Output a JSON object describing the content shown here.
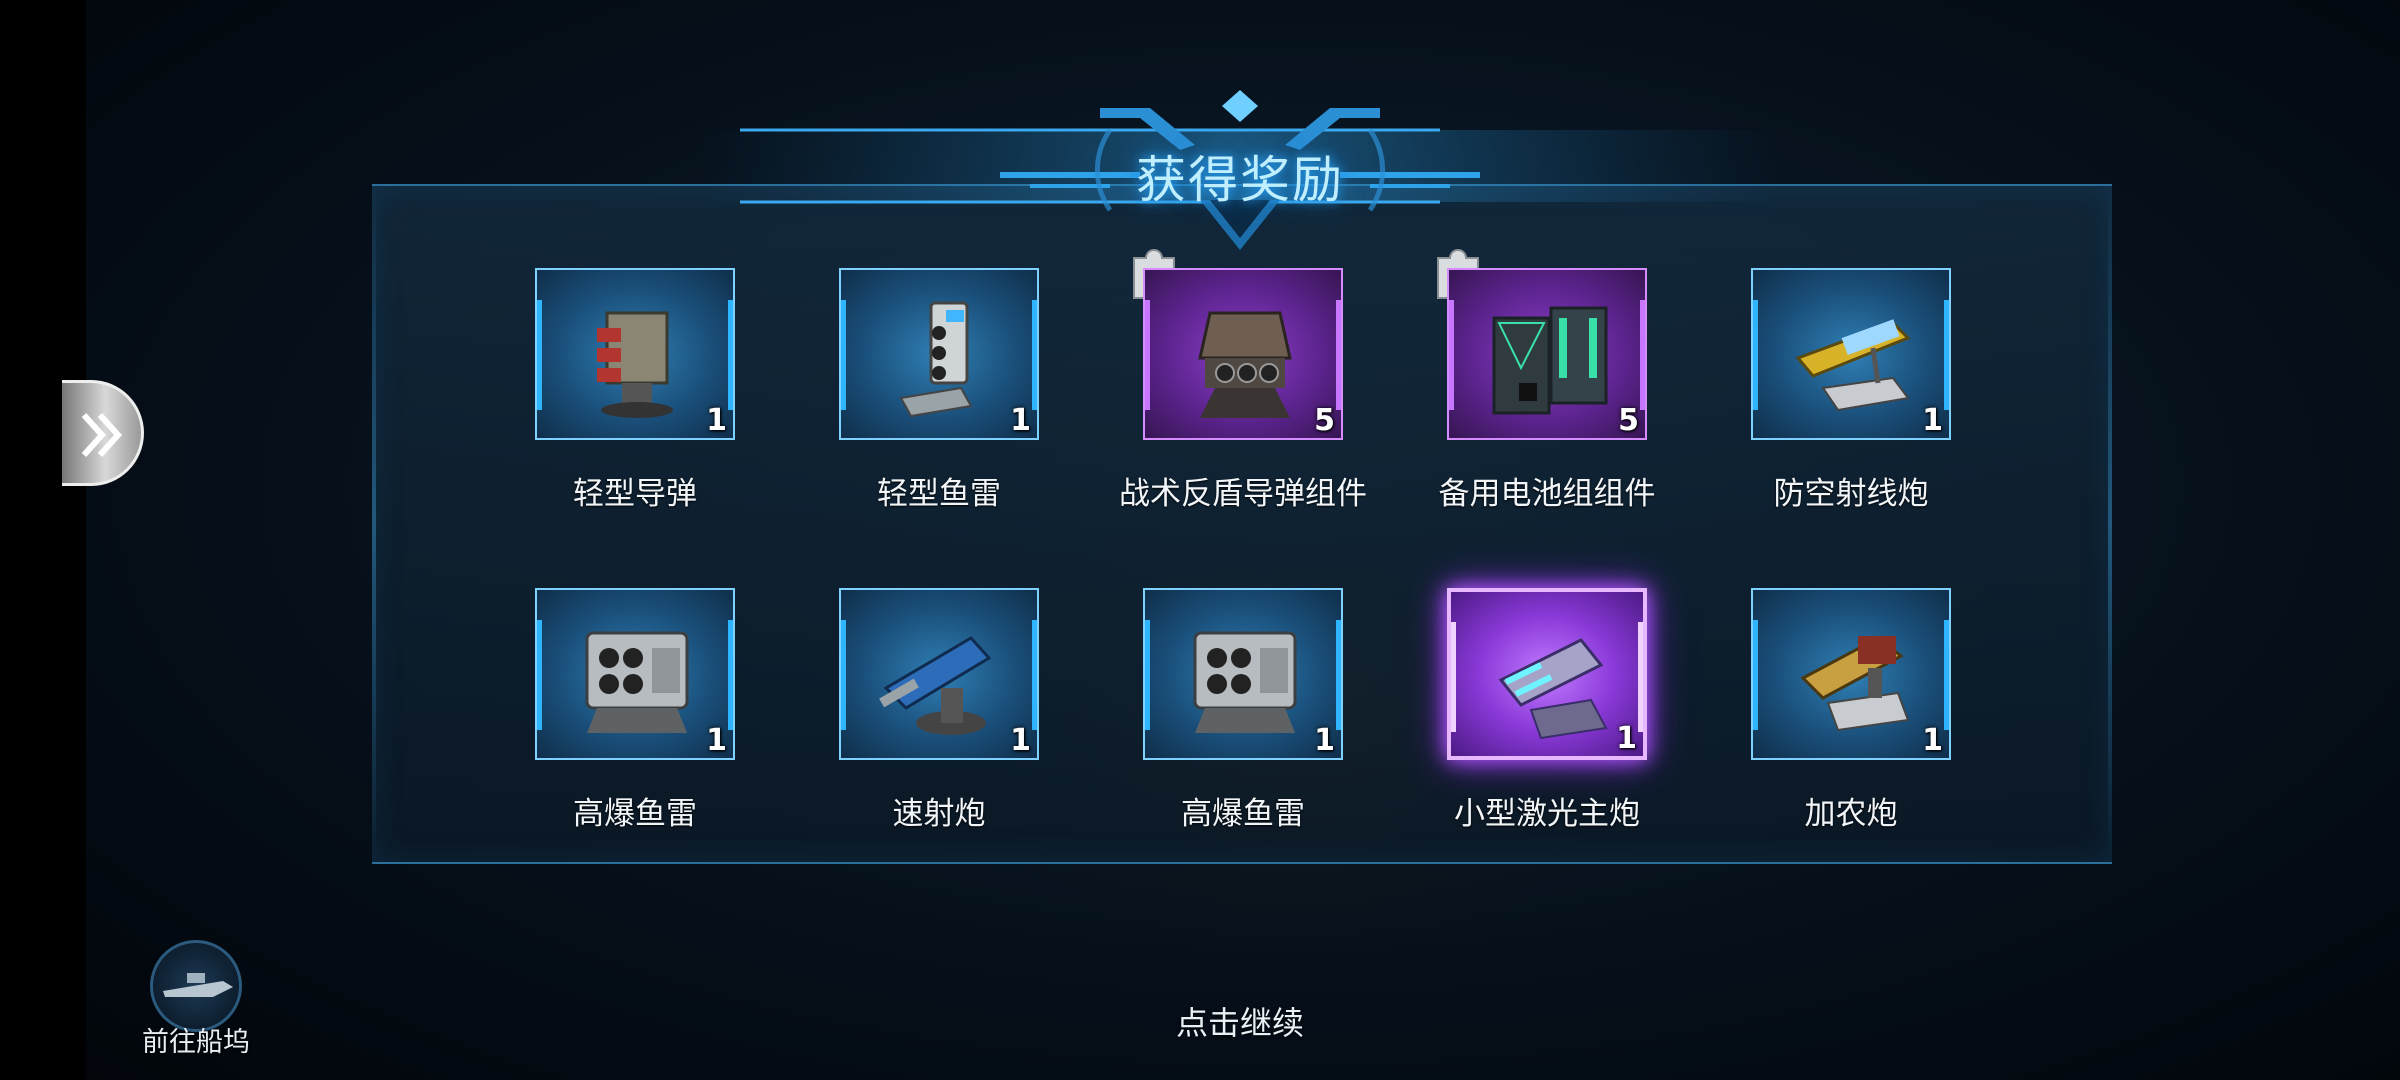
{
  "title": "获得奖励",
  "items": [
    {
      "name": "轻型导弹",
      "count": "1",
      "rarity": "blue",
      "fragment": false,
      "icon": "missile-launcher-icon"
    },
    {
      "name": "轻型鱼雷",
      "count": "1",
      "rarity": "blue",
      "fragment": false,
      "icon": "torpedo-launcher-icon"
    },
    {
      "name": "战术反盾导弹组件",
      "count": "5",
      "rarity": "purple",
      "fragment": true,
      "icon": "anti-shield-missile-icon"
    },
    {
      "name": "备用电池组组件",
      "count": "5",
      "rarity": "purple",
      "fragment": true,
      "icon": "battery-pack-icon"
    },
    {
      "name": "防空射线炮",
      "count": "1",
      "rarity": "blue",
      "fragment": false,
      "icon": "aa-ray-cannon-icon"
    },
    {
      "name": "高爆鱼雷",
      "count": "1",
      "rarity": "blue",
      "fragment": false,
      "icon": "he-torpedo-icon"
    },
    {
      "name": "速射炮",
      "count": "1",
      "rarity": "blue",
      "fragment": false,
      "icon": "rapid-fire-cannon-icon"
    },
    {
      "name": "高爆鱼雷",
      "count": "1",
      "rarity": "blue",
      "fragment": false,
      "icon": "he-torpedo-icon"
    },
    {
      "name": "小型激光主炮",
      "count": "1",
      "rarity": "glow",
      "fragment": false,
      "icon": "laser-main-cannon-icon"
    },
    {
      "name": "加农炮",
      "count": "1",
      "rarity": "blue",
      "fragment": false,
      "icon": "cannon-icon"
    }
  ],
  "dock_label": "前往船坞",
  "continue_label": "点击继续",
  "colors": {
    "accent": "#2fb4ff",
    "purple": "#c776ff",
    "title_glow": "#2aa8ff"
  }
}
